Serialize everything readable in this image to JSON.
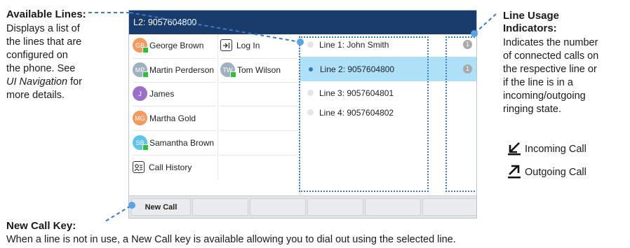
{
  "callouts": {
    "available_lines": {
      "title": "Available Lines:",
      "line1": "Displays a list of",
      "line2": "the lines that are",
      "line3": "configured on",
      "line4": "the phone. See",
      "link": "UI Navigation",
      "line5_rest": " for",
      "line6": "more details."
    },
    "line_usage": {
      "title1": "Line Usage",
      "title2": "Indicators:",
      "lines": [
        "Indicates the number",
        "of connected calls on",
        "the respective line or",
        "if the line is in a",
        "incoming/outgoing",
        "ringing state."
      ],
      "incoming": "Incoming Call",
      "outgoing": "Outgoing Call"
    },
    "new_call_key": {
      "title": "New Call Key:",
      "text": "When a line is not in use, a New Call key is available allowing you to dial out using the selected line."
    }
  },
  "phone": {
    "title": "L2: 9057604800",
    "contacts": [
      {
        "initials": "GB",
        "name": "George Brown",
        "color": "#f29a5f",
        "presence": true
      },
      {
        "initials": "MP",
        "name": "Martin Perderson",
        "color": "#9fb1c1",
        "presence": true
      },
      {
        "initials": "J",
        "name": "James",
        "color": "#9a6fc8",
        "presence": false
      },
      {
        "initials": "MG",
        "name": "Martha Gold",
        "color": "#f29a5f",
        "presence": false
      },
      {
        "initials": "SB",
        "name": "Samantha Brown",
        "color": "#5fc3ea",
        "presence": true
      }
    ],
    "call_history": "Call History",
    "col2": {
      "login": "Log In",
      "contact": {
        "initials": "TW",
        "name": "Tom Wilson",
        "color": "#9fb1c1",
        "presence": true
      }
    },
    "lines": [
      {
        "label": "Line 1: John Smith",
        "selected": false,
        "badge": "1"
      },
      {
        "label": "Line 2: 9057604800",
        "selected": true,
        "badge": "1"
      },
      {
        "label": "Line 3: 9057604801",
        "selected": false
      },
      {
        "label": "Line 4: 9057604802",
        "selected": false
      }
    ],
    "softkeys": [
      "New Call",
      "",
      "",
      "",
      "",
      ""
    ]
  },
  "colors": {
    "titlebar": "#1a3c6c",
    "selected_row": "#aee1f8",
    "dotted": "#3d79c4",
    "presence": "#2fbf3a"
  },
  "icons": {
    "login": "login-arrow-icon",
    "history": "call-history-icon",
    "incoming": "incoming-call-icon",
    "outgoing": "outgoing-call-icon"
  }
}
